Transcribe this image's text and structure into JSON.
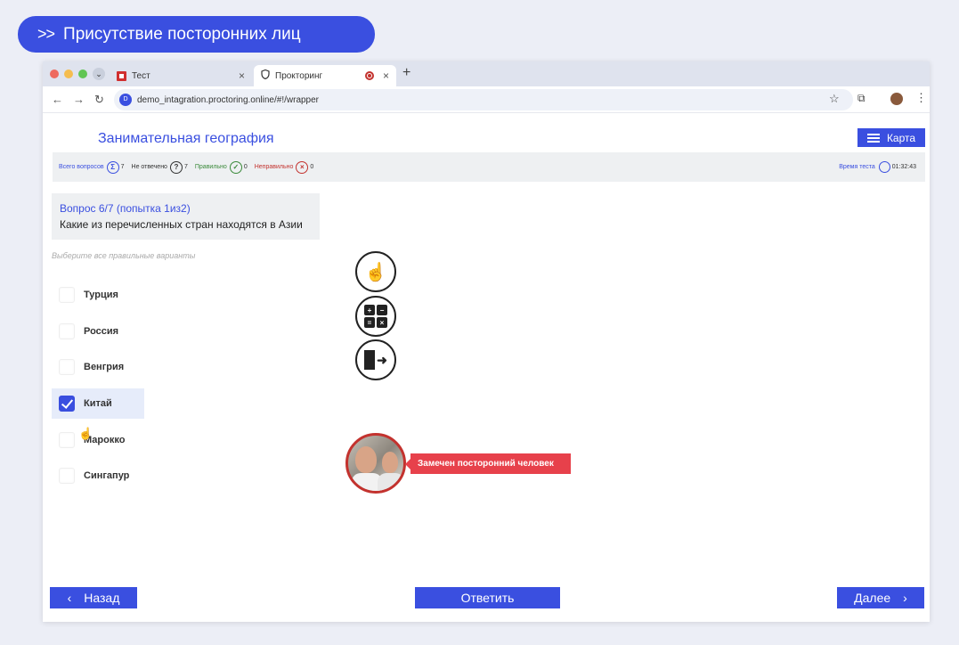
{
  "banner": {
    "arrows": ">>",
    "text": "Присутствие посторонних лиц"
  },
  "browser": {
    "tabs": [
      {
        "title": "Тест",
        "close": "×"
      },
      {
        "title": "Прокторинг",
        "close": "×"
      }
    ],
    "new_tab": "+",
    "url": "demo_intagration.proctoring.online/#!/wrapper",
    "site_icon": "D"
  },
  "app": {
    "title": "Занимательная география",
    "map_button": "Карта"
  },
  "stats": {
    "total_label": "Всего вопросов",
    "total_icon": "Σ",
    "total": "7",
    "unanswered_label": "Не отвечено",
    "unanswered_icon": "?",
    "unanswered": "7",
    "correct_label": "Правильно",
    "correct_icon": "✓",
    "correct": "0",
    "wrong_label": "Неправильно",
    "wrong_icon": "×",
    "wrong": "0",
    "time_label": "Время теста",
    "time": "01:32:43"
  },
  "question": {
    "header": "Вопрос 6/7  (попытка 1из2)",
    "text": "Какие из перечисленных стран находятся в Азии",
    "hint": "Выберите все правильные варианты"
  },
  "options": [
    {
      "label": "Турция",
      "checked": false
    },
    {
      "label": "Россия",
      "checked": false
    },
    {
      "label": "Венгрия",
      "checked": false
    },
    {
      "label": "Китай",
      "checked": true
    },
    {
      "label": "Марокко",
      "checked": false
    },
    {
      "label": "Сингапур",
      "checked": false
    }
  ],
  "proctor": {
    "calc_keys": [
      "+",
      "−",
      "=",
      "×"
    ],
    "alert": "Замечен посторонний человек"
  },
  "footer": {
    "back": "Назад",
    "back_icon": "‹",
    "answer": "Ответить",
    "next": "Далее",
    "next_icon": "›"
  }
}
